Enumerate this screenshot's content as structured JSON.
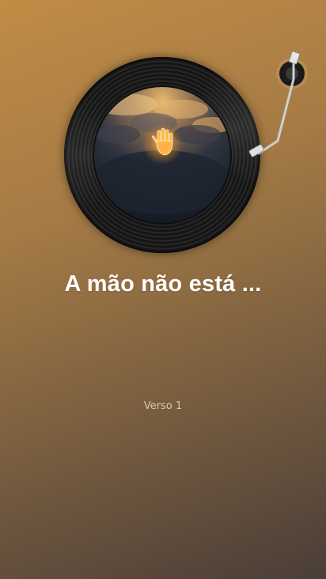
{
  "player": {
    "song_title": "A mão não está ...",
    "lyrics_line": "Verso 1",
    "cover_icon": "glowing-hand-in-clouds",
    "colors": {
      "background_top": "#c08c45",
      "background_bottom": "#4a3e38",
      "record": "#141414",
      "title_text": "#ffffff",
      "lyrics_text": "#d6c8b4"
    }
  }
}
